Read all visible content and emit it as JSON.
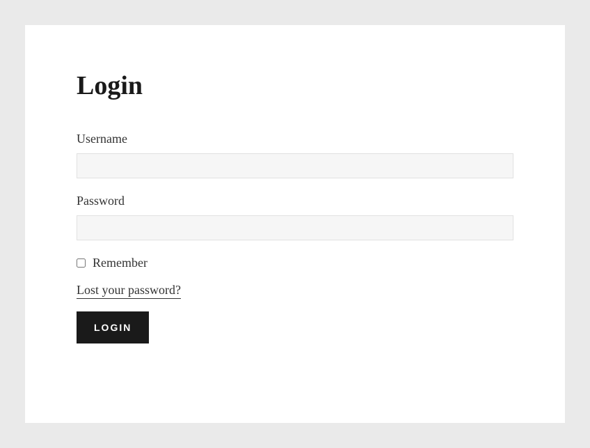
{
  "page": {
    "title": "Login"
  },
  "form": {
    "username_label": "Username",
    "username_value": "",
    "password_label": "Password",
    "password_value": "",
    "remember_label": "Remember",
    "lost_password_label": "Lost your password?",
    "submit_label": "LOGIN"
  }
}
